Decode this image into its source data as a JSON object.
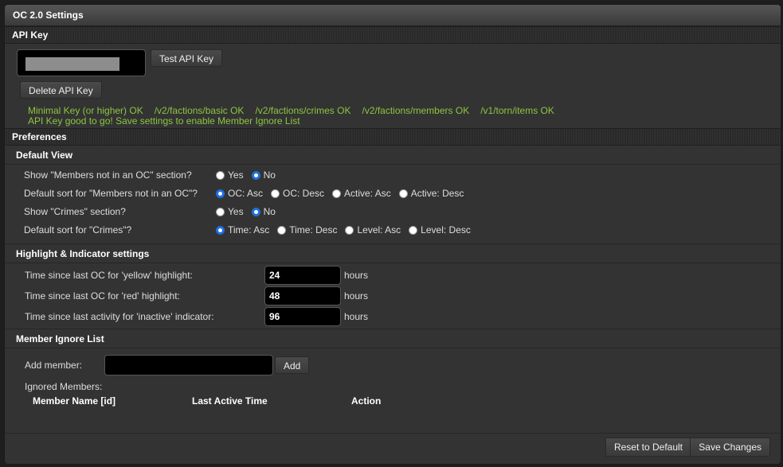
{
  "title": "OC 2.0 Settings",
  "api_key": {
    "section_label": "API Key",
    "test_button": "Test API Key",
    "delete_button": "Delete API Key",
    "checks": [
      "Minimal Key (or higher) OK",
      "/v2/factions/basic OK",
      "/v2/factions/crimes OK",
      "/v2/factions/members OK",
      "/v1/torn/items OK"
    ],
    "status_message": "API Key good to go! Save settings to enable Member Ignore List"
  },
  "preferences": {
    "section_label": "Preferences",
    "default_view": {
      "label": "Default View",
      "rows": [
        {
          "label": "Show \"Members not in an OC\" section?",
          "options": [
            "Yes",
            "No"
          ],
          "selected": "No"
        },
        {
          "label": "Default sort for \"Members not in an OC\"?",
          "options": [
            "OC: Asc",
            "OC: Desc",
            "Active: Asc",
            "Active: Desc"
          ],
          "selected": "OC: Asc"
        },
        {
          "label": "Show \"Crimes\" section?",
          "options": [
            "Yes",
            "No"
          ],
          "selected": "No"
        },
        {
          "label": "Default sort for \"Crimes\"?",
          "options": [
            "Time: Asc",
            "Time: Desc",
            "Level: Asc",
            "Level: Desc"
          ],
          "selected": "Time: Asc"
        }
      ]
    },
    "highlight": {
      "label": "Highlight & Indicator settings",
      "rows": [
        {
          "label": "Time since last OC for 'yellow' highlight:",
          "value": "24",
          "unit": "hours"
        },
        {
          "label": "Time since last OC for 'red' highlight:",
          "value": "48",
          "unit": "hours"
        },
        {
          "label": "Time since last activity for 'inactive' indicator:",
          "value": "96",
          "unit": "hours"
        }
      ]
    },
    "ignore_list": {
      "label": "Member Ignore List",
      "add_label": "Add member:",
      "add_value": "",
      "add_button": "Add",
      "ignored_label": "Ignored Members:",
      "columns": [
        "Member Name [id]",
        "Last Active Time",
        "Action"
      ]
    }
  },
  "footer": {
    "reset_button": "Reset to Default",
    "save_button": "Save Changes"
  },
  "colors": {
    "ok": "#8dc63f",
    "radio_selected": "#1e6fe0"
  }
}
